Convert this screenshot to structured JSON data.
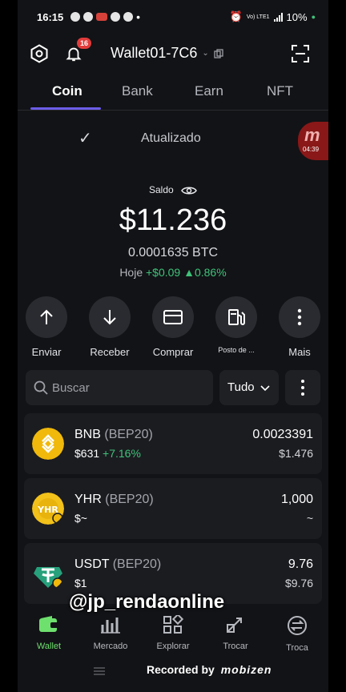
{
  "status_bar": {
    "time": "16:15",
    "network": "Vo) LTE1",
    "battery": "10%"
  },
  "header": {
    "notification_count": "16",
    "wallet_name": "Wallet01-7C6"
  },
  "tabs": [
    "Coin",
    "Bank",
    "Earn",
    "NFT"
  ],
  "active_tab": "Coin",
  "sync_status": "Atualizado",
  "recorder_overlay": {
    "logo": "m",
    "time": "04:39"
  },
  "balance": {
    "label": "Saldo",
    "amount": "$11.236",
    "btc": "0.0001635 BTC",
    "today_label": "Hoje",
    "today_change": "+$0.09",
    "today_pct": "0.86%"
  },
  "actions": [
    {
      "label": "Enviar",
      "icon": "arrow-up-icon"
    },
    {
      "label": "Receber",
      "icon": "arrow-down-icon"
    },
    {
      "label": "Comprar",
      "icon": "card-icon"
    },
    {
      "label": "Posto de ...",
      "icon": "fuel-icon"
    },
    {
      "label": "Mais",
      "icon": "more-vertical-icon"
    }
  ],
  "search": {
    "placeholder": "Buscar",
    "filter": "Tudo"
  },
  "tokens": [
    {
      "symbol": "BNB",
      "network": "(BEP20)",
      "price": "$631",
      "change": "+7.16%",
      "amount": "0.0023391",
      "value": "$1.476"
    },
    {
      "symbol": "YHR",
      "network": "(BEP20)",
      "price": "$~",
      "change": "",
      "amount": "1,000",
      "value": "~"
    },
    {
      "symbol": "USDT",
      "network": "(BEP20)",
      "price": "$1",
      "change": "",
      "amount": "9.76",
      "value": "$9.76"
    }
  ],
  "watermark": "@jp_rendaonline",
  "bottom_nav": [
    "Wallet",
    "Mercado",
    "Explorar",
    "Trocar",
    "Troca"
  ],
  "recorded_by": "Recorded by",
  "recorder_brand": "mobizen",
  "colors": {
    "accent": "#6c5ce7",
    "positive": "#3fc27a",
    "bnb": "#f0b90b",
    "usdt": "#26a17b",
    "nav_active": "#6ee06e"
  }
}
